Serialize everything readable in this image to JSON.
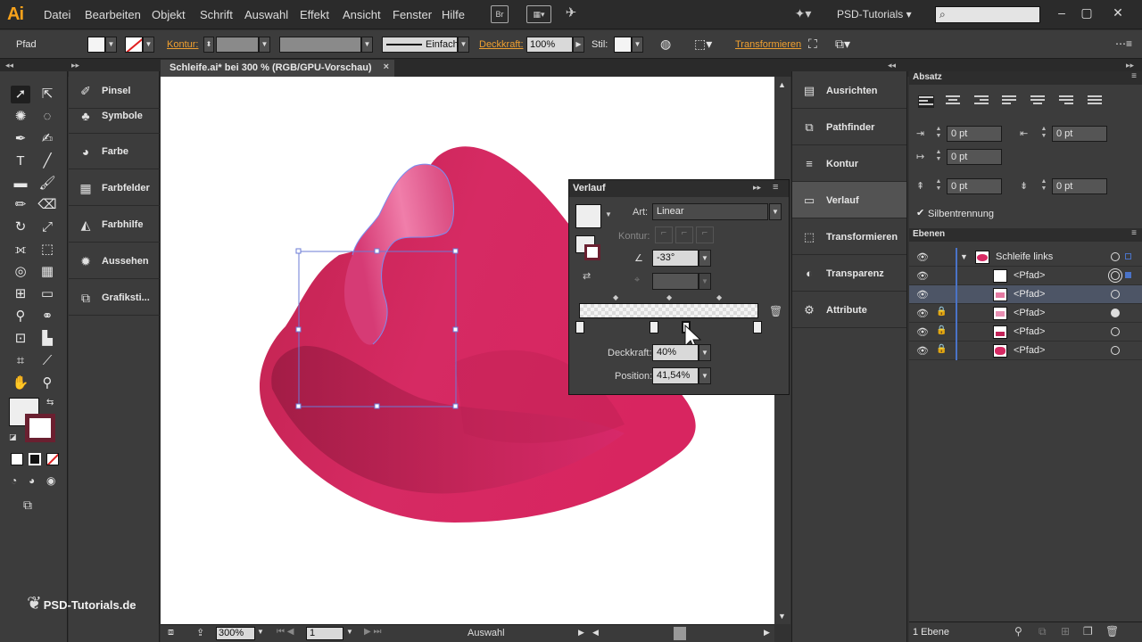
{
  "app": {
    "logo": "Ai",
    "workspace": "PSD-Tutorials",
    "br_label": "Br"
  },
  "menu": [
    "Datei",
    "Bearbeiten",
    "Objekt",
    "Schrift",
    "Auswahl",
    "Effekt",
    "Ansicht",
    "Fenster",
    "Hilfe"
  ],
  "controlbar": {
    "object_type": "Pfad",
    "kontur_label": "Kontur:",
    "stroke_style": "Einfach",
    "opacity_label": "Deckkraft:",
    "opacity_value": "100%",
    "style_label": "Stil:",
    "transform_label": "Transformieren"
  },
  "document": {
    "tab_title": "Schleife.ai* bei 300 % (RGB/GPU-Vorschau)",
    "close": "×"
  },
  "status": {
    "zoom": "300%",
    "page": "1",
    "tool": "Auswahl"
  },
  "left_panels": [
    {
      "label": "Pinsel",
      "icon": "brush-icon"
    },
    {
      "label": "Symbole",
      "icon": "symbols-icon"
    },
    {
      "label": "Farbe",
      "icon": "palette-icon"
    },
    {
      "label": "Farbfelder",
      "icon": "swatches-icon"
    },
    {
      "label": "Farbhilfe",
      "icon": "color-guide-icon"
    },
    {
      "label": "Aussehen",
      "icon": "appearance-icon"
    },
    {
      "label": "Grafiksti...",
      "icon": "graphic-styles-icon"
    }
  ],
  "mid_panels": [
    {
      "label": "Ausrichten",
      "icon": "align-icon",
      "selected": false
    },
    {
      "label": "Pathfinder",
      "icon": "pathfinder-icon",
      "selected": false
    },
    {
      "label": "Kontur",
      "icon": "stroke-icon",
      "selected": false
    },
    {
      "label": "Verlauf",
      "icon": "gradient-icon",
      "selected": true
    },
    {
      "label": "Transformieren",
      "icon": "transform-icon",
      "selected": false
    },
    {
      "label": "Transparenz",
      "icon": "transparency-icon",
      "selected": false
    },
    {
      "label": "Attribute",
      "icon": "attributes-icon",
      "selected": false
    }
  ],
  "gradient_panel": {
    "title": "Verlauf",
    "type_label": "Art:",
    "type_value": "Linear",
    "stroke_label": "Kontur:",
    "angle_value": "-33°",
    "opacity_label": "Deckkraft:",
    "opacity_value": "40%",
    "position_label": "Position:",
    "position_value": "41,54%"
  },
  "paragraph_panel": {
    "title": "Absatz",
    "left_indent": "0 pt",
    "right_indent": "0 pt",
    "first_line_indent": "0 pt",
    "space_before": "0 pt",
    "space_after": "0 pt",
    "hyphenation_label": "Silbentrennung"
  },
  "layers_panel": {
    "title": "Ebenen",
    "group_name": "Schleife links",
    "rows": [
      "<Pfad>",
      "<Pfad>",
      "<Pfad>",
      "<Pfad>",
      "<Pfad>"
    ],
    "footer": "1 Ebene"
  },
  "watermark": "PSD-Tutorials.de",
  "colors": {
    "accent_orange": "#f7a21b",
    "ribbon_pink": "#d62a63",
    "selection_blue": "#4a73c7"
  }
}
